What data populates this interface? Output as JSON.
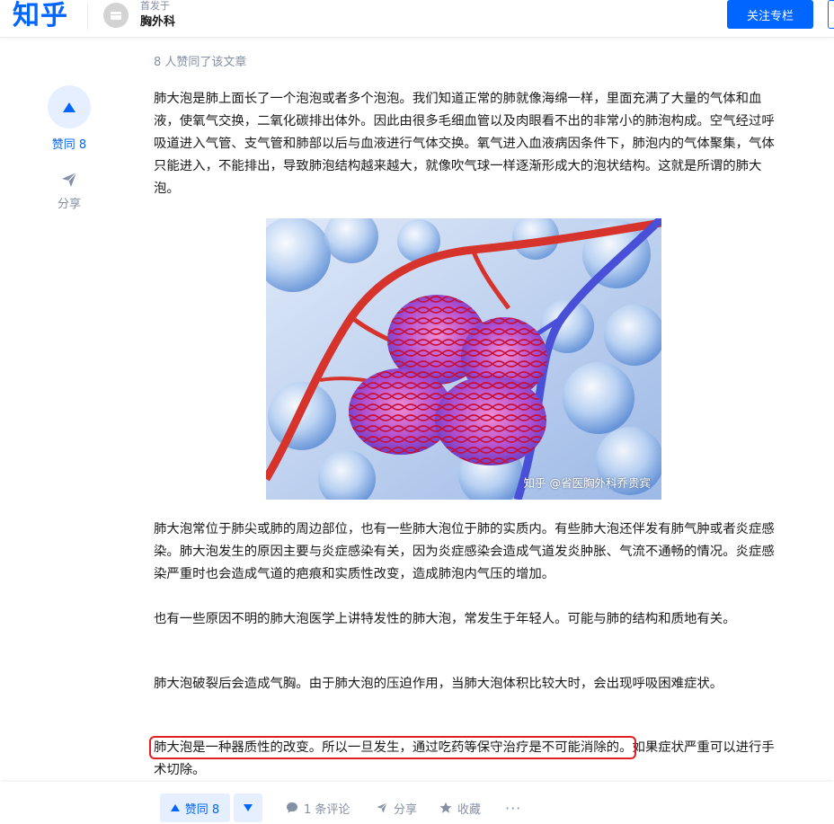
{
  "header": {
    "logo": "知乎",
    "first_published_label": "首发于",
    "column_name": "胸外科",
    "follow_button": "关注专栏"
  },
  "likers_text": "8 人赞同了该文章",
  "side": {
    "vote_label": "赞同 8",
    "share_label": "分享"
  },
  "article": {
    "p1": "肺大泡是肺上面长了一个泡泡或者多个泡泡。我们知道正常的肺就像海绵一样，里面充满了大量的气体和血液，使氧气交换，二氧化碳排出体外。因此由很多毛细血管以及肉眼看不出的非常小的肺泡构成。空气经过呼吸道进入气管、支气管和肺部以后与血液进行气体交换。氧气进入血液病因条件下，肺泡内的气体聚集，气体只能进入，不能排出，导致肺泡结构越来越大，就像吹气球一样逐渐形成大的泡状结构。这就是所谓的肺大泡。",
    "image_watermark": "知乎 @省医胸外科乔贵宾",
    "p2": "肺大泡常位于肺尖或肺的周边部位，也有一些肺大泡位于肺的实质内。有些肺大泡还伴发有肺气肿或者炎症感染。肺大泡发生的原因主要与炎症感染有关，因为炎症感染会造成气道发炎肿胀、气流不通畅的情况。炎症感染严重时也会造成气道的疤痕和实质性改变，造成肺泡内气压的增加。",
    "p3": "也有一些原因不明的肺大泡医学上讲特发性的肺大泡，常发生于年轻人。可能与肺的结构和质地有关。",
    "p4": "肺大泡破裂后会造成气胸。由于肺大泡的压迫作用，当肺大泡体积比较大时，会出现呼吸困难症状。",
    "p5_highlight": "肺大泡是一种器质性的改变。所以一旦发生，通过吃药等保守治疗是不可能消除的。",
    "p5_rest": "如果症状严重可以进行手术切除。"
  },
  "bottom_bar": {
    "vote_label": "赞同 8",
    "comment_label": "1 条评论",
    "share_label": "分享",
    "favorite_label": "收藏",
    "more_label": "···"
  },
  "colors": {
    "brand": "#0066ff",
    "highlight_box": "#e02020",
    "muted": "#8590a6"
  }
}
